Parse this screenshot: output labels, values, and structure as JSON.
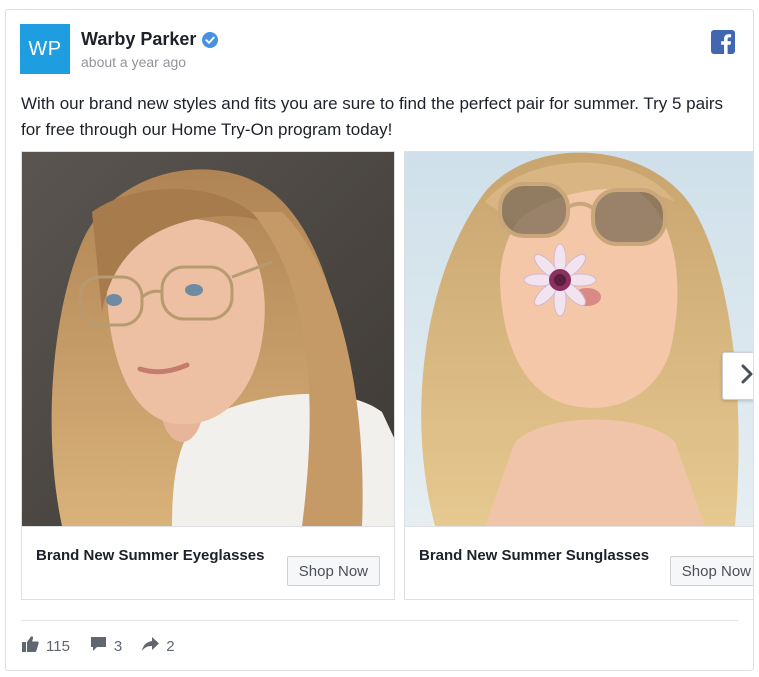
{
  "post": {
    "avatar_text": "WP",
    "page_name": "Warby Parker",
    "timestamp": "about a year ago",
    "message": "With our brand new styles and fits you are sure to find the perfect pair for summer. Try 5 pairs for free through our Home Try-On program today!"
  },
  "carousel": {
    "cards": [
      {
        "title": "Brand New Summer Eyeglasses",
        "cta": "Shop Now",
        "image": "woman-wearing-eyeglasses-photo"
      },
      {
        "title": "Brand New Summer Sunglasses",
        "cta": "Shop Now",
        "image": "woman-wearing-sunglasses-with-flower-photo"
      }
    ],
    "next_icon": "chevron-right-icon"
  },
  "engagement": {
    "likes": "115",
    "comments": "3",
    "shares": "2",
    "icons": [
      "thumbs-up-icon",
      "comment-icon",
      "share-arrow-icon"
    ]
  },
  "colors": {
    "avatar_bg": "#1e9de0",
    "facebook_blue": "#4267b2",
    "verified_blue": "#4a90e2",
    "muted_text": "#90949c"
  }
}
